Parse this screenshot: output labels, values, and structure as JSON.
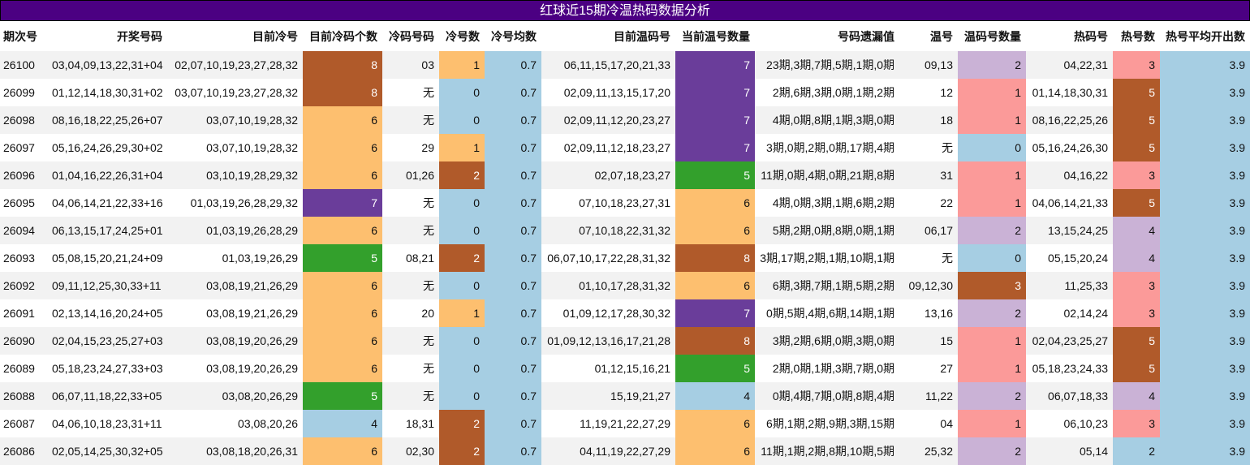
{
  "title": "红球近15期冷温热码数据分析",
  "colors": {
    "title_bg": "#4b0082",
    "brown": "#b05a2a",
    "orange": "#fdbf6f",
    "purple": "#6a3d9a",
    "green": "#33a02c",
    "lightblue": "#a6cee3",
    "lavender": "#cab2d6",
    "pink": "#fb9a99",
    "stripe": "#f2f2f2"
  },
  "headers": [
    "期次号",
    "开奖号码",
    "目前冷号",
    "目前冷码个数",
    "冷码号码",
    "冷号数",
    "冷号均数",
    "目前温码号",
    "当前温号数量",
    "号码遗漏值",
    "温号",
    "温码号数量",
    "热码号",
    "热号数",
    "热号平均开出数"
  ],
  "rows": [
    [
      "26100",
      "03,04,09,13,22,31+04",
      "02,07,10,19,23,27,28,32",
      "8",
      "03",
      "1",
      "0.7",
      "06,11,15,17,20,21,33",
      "7",
      "23期,3期,7期,5期,1期,0期",
      "09,13",
      "2",
      "04,22,31",
      "3",
      "3.9"
    ],
    [
      "26099",
      "01,12,14,18,30,31+02",
      "03,07,10,19,23,27,28,32",
      "8",
      "无",
      "0",
      "0.7",
      "02,09,11,13,15,17,20",
      "7",
      "2期,6期,3期,0期,1期,2期",
      "12",
      "1",
      "01,14,18,30,31",
      "5",
      "3.9"
    ],
    [
      "26098",
      "08,16,18,22,25,26+07",
      "03,07,10,19,28,32",
      "6",
      "无",
      "0",
      "0.7",
      "02,09,11,12,20,23,27",
      "7",
      "4期,0期,8期,1期,3期,0期",
      "18",
      "1",
      "08,16,22,25,26",
      "5",
      "3.9"
    ],
    [
      "26097",
      "05,16,24,26,29,30+02",
      "03,07,10,19,28,32",
      "6",
      "29",
      "1",
      "0.7",
      "02,09,11,12,18,23,27",
      "7",
      "3期,0期,2期,0期,17期,4期",
      "无",
      "0",
      "05,16,24,26,30",
      "5",
      "3.9"
    ],
    [
      "26096",
      "01,04,16,22,26,31+04",
      "03,10,19,28,29,32",
      "6",
      "01,26",
      "2",
      "0.7",
      "02,07,18,23,27",
      "5",
      "11期,0期,4期,0期,21期,8期",
      "31",
      "1",
      "04,16,22",
      "3",
      "3.9"
    ],
    [
      "26095",
      "04,06,14,21,22,33+16",
      "01,03,19,26,28,29,32",
      "7",
      "无",
      "0",
      "0.7",
      "07,10,18,23,27,31",
      "6",
      "4期,0期,3期,1期,6期,2期",
      "22",
      "1",
      "04,06,14,21,33",
      "5",
      "3.9"
    ],
    [
      "26094",
      "06,13,15,17,24,25+01",
      "01,03,19,26,28,29",
      "6",
      "无",
      "0",
      "0.7",
      "07,10,18,22,31,32",
      "6",
      "5期,2期,0期,8期,0期,1期",
      "06,17",
      "2",
      "13,15,24,25",
      "4",
      "3.9"
    ],
    [
      "26093",
      "05,08,15,20,21,24+09",
      "01,03,19,26,29",
      "5",
      "08,21",
      "2",
      "0.7",
      "06,07,10,17,22,28,31,32",
      "8",
      "3期,17期,2期,1期,10期,1期",
      "无",
      "0",
      "05,15,20,24",
      "4",
      "3.9"
    ],
    [
      "26092",
      "09,11,12,25,30,33+11",
      "03,08,19,21,26,29",
      "6",
      "无",
      "0",
      "0.7",
      "01,10,17,28,31,32",
      "6",
      "6期,3期,7期,1期,5期,2期",
      "09,12,30",
      "3",
      "11,25,33",
      "3",
      "3.9"
    ],
    [
      "26091",
      "02,13,14,16,20,24+05",
      "03,08,19,21,26,29",
      "6",
      "20",
      "1",
      "0.7",
      "01,09,12,17,28,30,32",
      "7",
      "0期,5期,4期,6期,14期,1期",
      "13,16",
      "2",
      "02,14,24",
      "3",
      "3.9"
    ],
    [
      "26090",
      "02,04,15,23,25,27+03",
      "03,08,19,20,26,29",
      "6",
      "无",
      "0",
      "0.7",
      "01,09,12,13,16,17,21,28",
      "8",
      "3期,2期,6期,0期,3期,0期",
      "15",
      "1",
      "02,04,23,25,27",
      "5",
      "3.9"
    ],
    [
      "26089",
      "05,18,23,24,27,33+03",
      "03,08,19,20,26,29",
      "6",
      "无",
      "0",
      "0.7",
      "01,12,15,16,21",
      "5",
      "2期,0期,1期,3期,7期,0期",
      "27",
      "1",
      "05,18,23,24,33",
      "5",
      "3.9"
    ],
    [
      "26088",
      "06,07,11,18,22,33+05",
      "03,08,20,26,29",
      "5",
      "无",
      "0",
      "0.7",
      "15,19,21,27",
      "4",
      "0期,4期,7期,0期,8期,4期",
      "11,22",
      "2",
      "06,07,18,33",
      "4",
      "3.9"
    ],
    [
      "26087",
      "04,06,10,18,23,31+11",
      "03,08,20,26",
      "4",
      "18,31",
      "2",
      "0.7",
      "11,19,21,22,27,29",
      "6",
      "6期,1期,2期,9期,3期,15期",
      "04",
      "1",
      "06,10,23",
      "3",
      "3.9"
    ],
    [
      "26086",
      "02,05,14,25,30,32+05",
      "03,08,18,20,26,31",
      "6",
      "02,30",
      "2",
      "0.7",
      "04,11,19,22,27,29",
      "6",
      "11期,1期,2期,8期,10期,5期",
      "25,32",
      "2",
      "05,14",
      "2",
      "3.9"
    ]
  ]
}
